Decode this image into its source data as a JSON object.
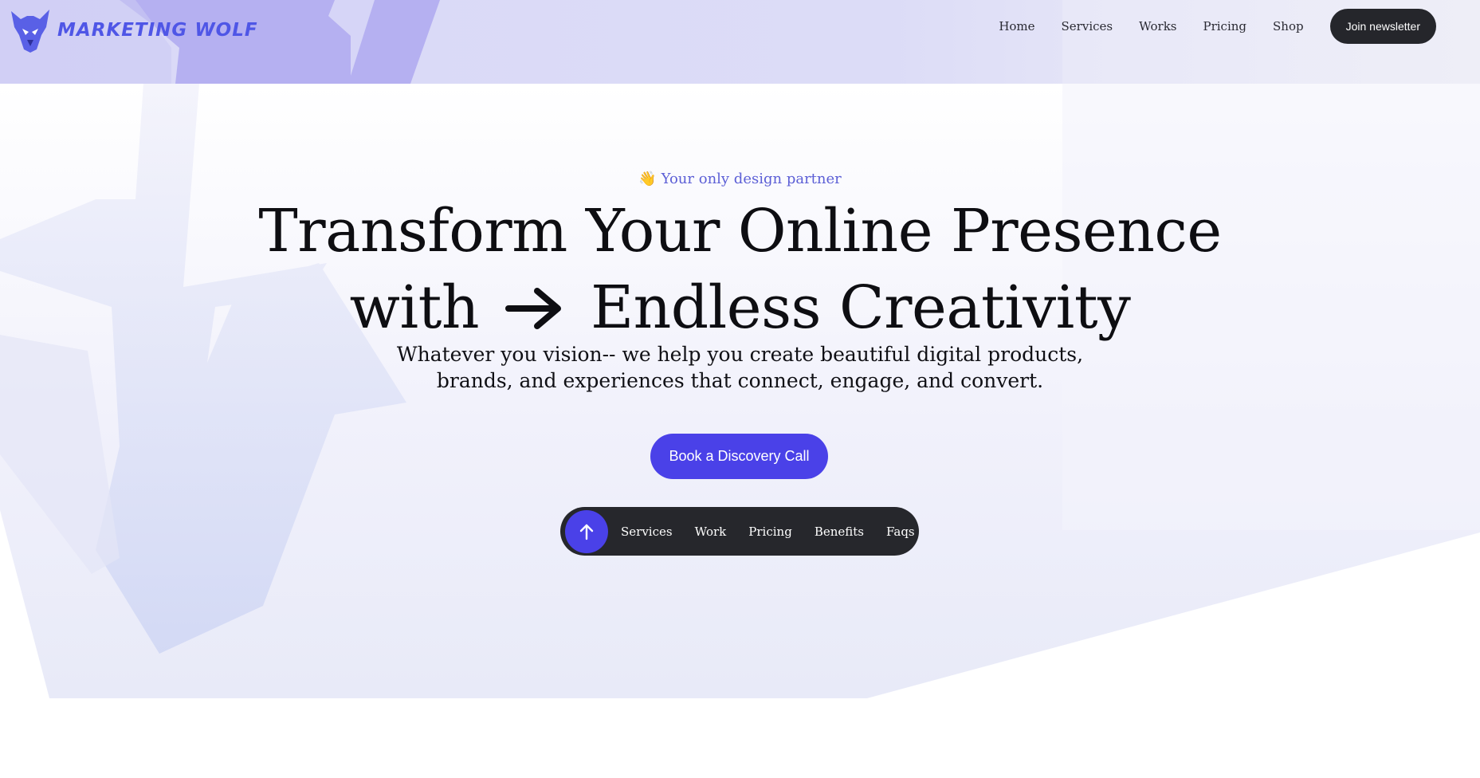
{
  "brand": {
    "name": "MARKETING WOLF",
    "accent_color": "#4f56e6"
  },
  "nav": {
    "items": [
      {
        "label": "Home"
      },
      {
        "label": "Services"
      },
      {
        "label": "Works"
      },
      {
        "label": "Pricing"
      },
      {
        "label": "Shop"
      }
    ],
    "cta_label": "Join newsletter"
  },
  "hero": {
    "eyebrow_icon": "waving-hand-icon",
    "eyebrow_icon_glyph": "👋",
    "eyebrow": "Your only design partner",
    "headline_line1": "Transform Your Online Presence",
    "headline_line2_before": "with",
    "headline_icon": "arrow-right-icon",
    "headline_line2_after": "Endless Creativity",
    "subtext_line1": "Whatever you vision-- we help you create beautiful digital products,",
    "subtext_line2": "brands, and experiences that connect, engage, and convert.",
    "cta_label": "Book a Discovery Call",
    "cta_color": "#4a41e8"
  },
  "section_nav": {
    "up_icon": "arrow-up-icon",
    "items": [
      {
        "label": "Services"
      },
      {
        "label": "Work"
      },
      {
        "label": "Pricing"
      },
      {
        "label": "Benefits"
      },
      {
        "label": "Faqs"
      }
    ]
  }
}
